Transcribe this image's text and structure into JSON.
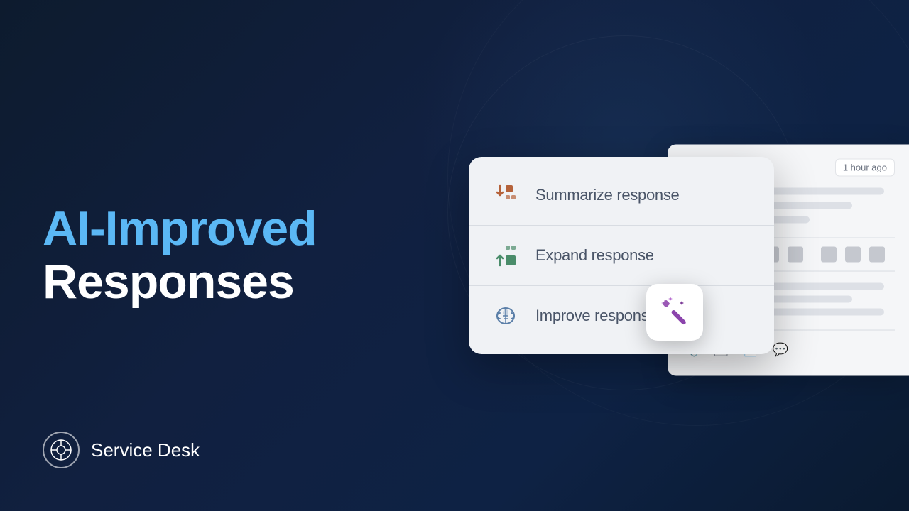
{
  "background": {
    "color": "#0d1b2e"
  },
  "headline": {
    "line1": "AI-Improved",
    "line2": "Responses"
  },
  "brand": {
    "name": "Service Desk"
  },
  "menu": {
    "items": [
      {
        "id": "summarize",
        "label": "Summarize response",
        "icon_type": "summarize"
      },
      {
        "id": "expand",
        "label": "Expand response",
        "icon_type": "expand"
      },
      {
        "id": "improve",
        "label": "Improve response",
        "icon_type": "improve"
      }
    ]
  },
  "ui_panel": {
    "timestamp": "1 hour ago"
  }
}
